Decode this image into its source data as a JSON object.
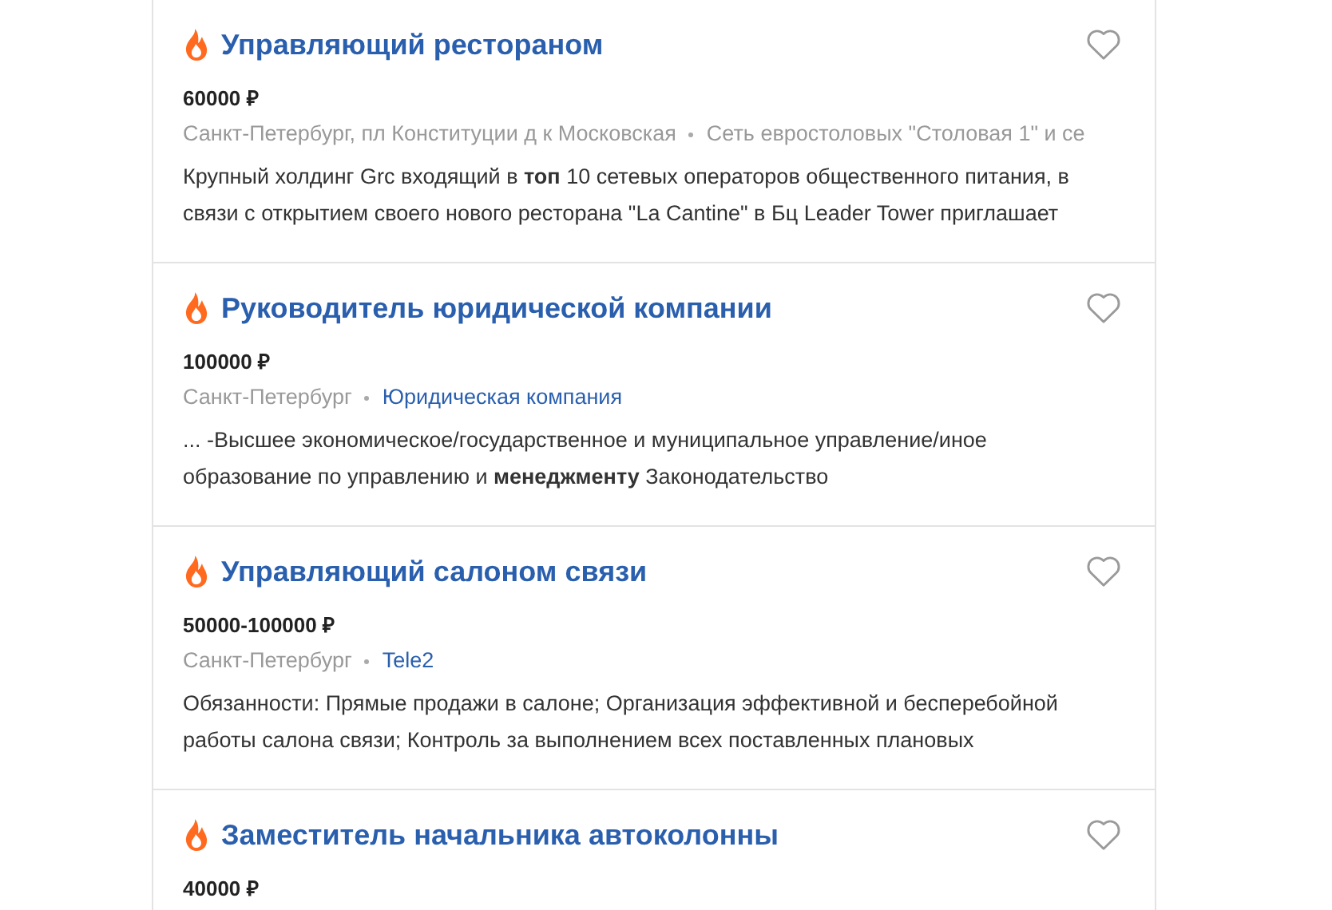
{
  "vacancies": [
    {
      "title": "Управляющий рестораном",
      "salary": "60000 ₽",
      "location": "Санкт-Петербург, пл Конституции д к Московская",
      "company": {
        "name": "Сеть евростоловых \"Столовая 1\" и се",
        "kind": "plain"
      },
      "description": "Крупный холдинг Grc входящий в **топ** 10 сетевых операторов общественного питания, в связи с открытием своего нового ресторана \"La Cantine\" в Бц Leader Tower приглашает"
    },
    {
      "title": "Руководитель юридической компании",
      "salary": "100000 ₽",
      "location": "Санкт-Петербург",
      "company": {
        "name": "Юридическая компания",
        "kind": "link"
      },
      "description": "... -Высшее экономическое/государственное и муниципальное управление/иное образование по управлению и **менеджменту** Законодательство"
    },
    {
      "title": "Управляющий салоном связи",
      "salary": "50000-100000 ₽",
      "location": "Санкт-Петербург",
      "company": {
        "name": "Tele2",
        "kind": "link"
      },
      "description": "Обязанности: Прямые продажи в салоне; Организация эффективной и бесперебойной работы салона связи; Контроль за выполнением всех поставленных плановых"
    },
    {
      "title": "Заместитель начальника автоколонны",
      "salary": "40000 ₽"
    }
  ]
}
